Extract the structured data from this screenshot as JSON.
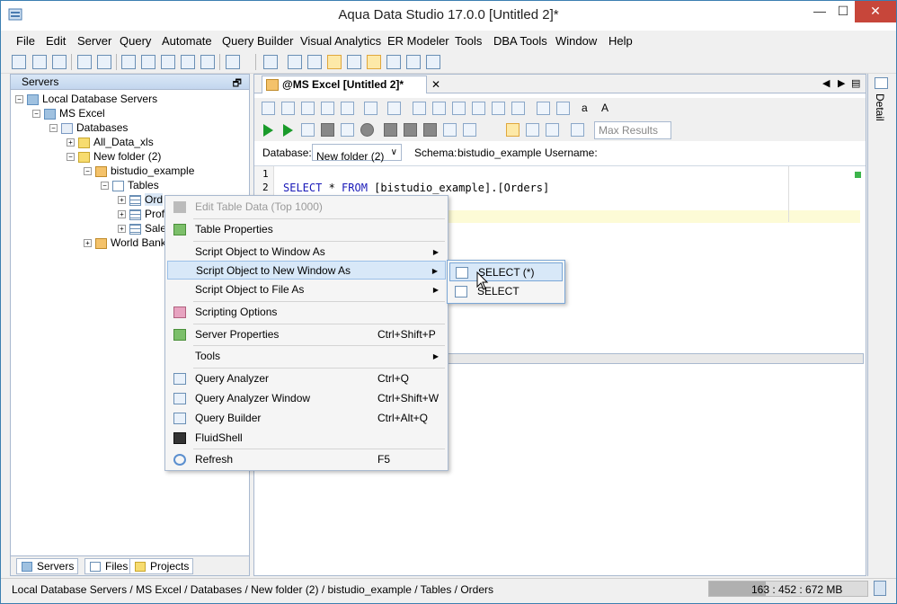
{
  "window": {
    "title": "Aqua Data Studio 17.0.0 [Untitled 2]*",
    "min": "—",
    "max": "☐",
    "close": "✕"
  },
  "menu": [
    "File",
    "Edit",
    "Server",
    "Query",
    "Automate",
    "Query Builder",
    "Visual Analytics",
    "ER Modeler",
    "Tools",
    "DBA Tools",
    "Window",
    "Help"
  ],
  "servers_panel": {
    "header": "Servers",
    "restore": "🗗",
    "tree": [
      {
        "label": "Local Database Servers",
        "icon": "server-group-icon"
      },
      {
        "label": "MS Excel",
        "icon": "server-icon"
      },
      {
        "label": "Databases",
        "icon": "databases-icon"
      },
      {
        "label": "All_Data_xls",
        "icon": "database-icon"
      },
      {
        "label": "New folder (2)",
        "icon": "database-icon"
      },
      {
        "label": "bistudio_example",
        "icon": "schema-icon"
      },
      {
        "label": "Tables",
        "icon": "tables-folder-icon"
      },
      {
        "label": "Ord",
        "icon": "table-icon"
      },
      {
        "label": "Prof",
        "icon": "table-icon"
      },
      {
        "label": "Sale",
        "icon": "table-icon"
      },
      {
        "label": "World Bank",
        "icon": "schema-icon"
      }
    ],
    "toggles": {
      "collapse": "−",
      "expand": "+"
    }
  },
  "bottom_tabs": [
    "Servers",
    "Files",
    "Projects"
  ],
  "editor": {
    "tab_label": "@MS Excel [Untitled 2]*",
    "tab_close": "✕",
    "nav": {
      "prev": "◀",
      "next": "▶",
      "list": "▤"
    },
    "max_results_placeholder": "Max Results",
    "database_label": "Database:",
    "database_value": "New folder (2)",
    "database_arrow": "∨",
    "schema_label": "Schema:",
    "schema_value": "bistudio_example",
    "username_label": "Username:",
    "font_small": "a",
    "font_large": "A",
    "line_numbers": [
      "1",
      "2"
    ],
    "sql": {
      "kw1": "SELECT",
      "star": " * ",
      "kw2": "FROM",
      "rest": " [bistudio_example].[Orders]"
    }
  },
  "detail_label": "Detail",
  "context_menu": {
    "items": [
      {
        "label": "Edit Table Data (Top 1000)",
        "shortcut": "",
        "submenu": false,
        "disabled": true
      },
      {
        "label": "Table Properties",
        "shortcut": "",
        "submenu": false
      },
      {
        "label": "Script Object to Window As",
        "shortcut": "",
        "submenu": true
      },
      {
        "label": "Script Object to New Window As",
        "shortcut": "",
        "submenu": true,
        "active": true
      },
      {
        "label": "Script Object to File As",
        "shortcut": "",
        "submenu": true
      },
      {
        "label": "Scripting Options",
        "shortcut": "",
        "submenu": false
      },
      {
        "label": "Server Properties",
        "shortcut": "Ctrl+Shift+P",
        "submenu": false
      },
      {
        "label": "Tools",
        "shortcut": "",
        "submenu": true
      },
      {
        "label": "Query Analyzer",
        "shortcut": "Ctrl+Q",
        "submenu": false
      },
      {
        "label": "Query Analyzer Window",
        "shortcut": "Ctrl+Shift+W",
        "submenu": false
      },
      {
        "label": "Query Builder",
        "shortcut": "Ctrl+Alt+Q",
        "submenu": false
      },
      {
        "label": "FluidShell",
        "shortcut": "",
        "submenu": false
      },
      {
        "label": "Refresh",
        "shortcut": "F5",
        "submenu": false
      }
    ],
    "arrow": "▶"
  },
  "submenu": {
    "items": [
      {
        "label": "SELECT (*)",
        "active": true
      },
      {
        "label": "SELECT"
      }
    ]
  },
  "statusbar": {
    "path": "Local Database Servers / MS Excel / Databases / New folder (2) / bistudio_example / Tables / Orders",
    "memory": "163 : 452 : 672 MB",
    "memory_used_fraction": 0.36
  }
}
